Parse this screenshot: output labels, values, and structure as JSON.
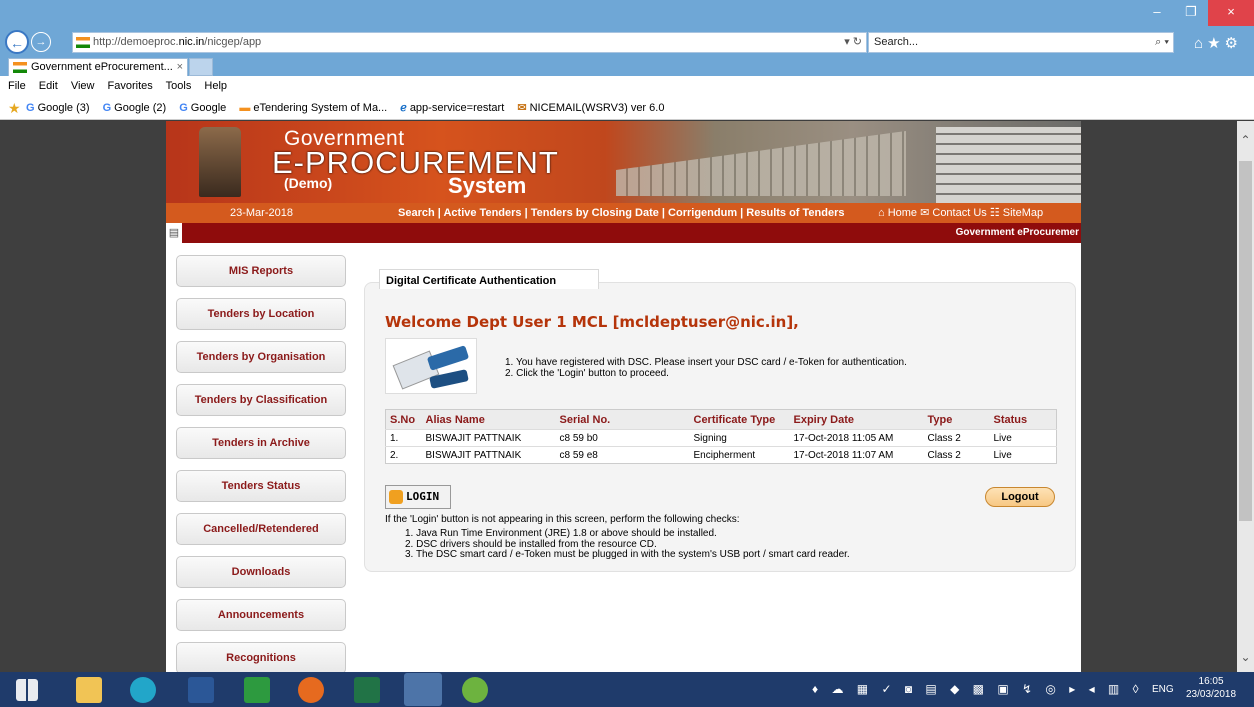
{
  "browser": {
    "url_prefix": "http://demoeproc.",
    "url_host": "nic.in",
    "url_path": "/nicgep/app",
    "refresh_glyph": "▾ ↻",
    "search_placeholder": "Search...",
    "search_glyph": "⌕ ▾",
    "nav_icons": "⌂★⚙",
    "tab_title": "Government eProcurement...",
    "tab_close": "×",
    "win_min": "–",
    "win_max": "❐",
    "win_close": "×",
    "back_glyph": "←",
    "fwd_glyph": "→"
  },
  "menu": [
    "File",
    "Edit",
    "View",
    "Favorites",
    "Tools",
    "Help"
  ],
  "favorites": [
    {
      "icon": "G",
      "label": "Google (3)"
    },
    {
      "icon": "G",
      "label": "Google (2)"
    },
    {
      "icon": "G",
      "label": "Google"
    },
    {
      "icon": "▬",
      "label": "eTendering System of Ma..."
    },
    {
      "icon": "ℯ",
      "label": "app-service=restart"
    },
    {
      "icon": "✉",
      "label": "NICEMAIL(WSRV3) ver 6.0"
    }
  ],
  "banner": {
    "line1": "Government",
    "line2": "E-PROCUREMENT",
    "line3": "(Demo)",
    "line4": "System"
  },
  "nav": {
    "date": "23-Mar-2018",
    "links": "Search  |  Active Tenders  |  Tenders by Closing Date  |  Corrigendum  |  Results of Tenders",
    "top_links": "⌂ Home   ✉ Contact Us   ☷ SiteMap",
    "marquee": "Government eProcuremer"
  },
  "sidebar": [
    "MIS Reports",
    "Tenders by Location",
    "Tenders by Organisation",
    "Tenders by Classification",
    "Tenders in Archive",
    "Tenders Status",
    "Cancelled/Retendered",
    "Downloads",
    "Announcements",
    "Recognitions"
  ],
  "auth": {
    "tab_label": "Digital Certificate Authentication",
    "welcome": "Welcome Dept User 1 MCL [mcldeptuser@nic.in],",
    "instructions": [
      "1.  You have registered with DSC. Please insert your DSC card / e-Token for authentication.",
      "2.  Click the 'Login' button to proceed."
    ],
    "columns": [
      "S.No",
      "Alias Name",
      "Serial No.",
      "Certificate Type",
      "Expiry Date",
      "Type",
      "Status"
    ],
    "rows": [
      [
        "1.",
        "BISWAJIT PATTNAIK",
        "c8 59 b0",
        "Signing",
        "17-Oct-2018 11:05 AM",
        "Class 2",
        "Live"
      ],
      [
        "2.",
        "BISWAJIT PATTNAIK",
        "c8 59 e8",
        "Encipherment",
        "17-Oct-2018 11:07 AM",
        "Class 2",
        "Live"
      ]
    ],
    "login_label": "LOGIN",
    "logout_label": "Logout",
    "checks_title": "If the 'Login' button is not appearing in this screen, perform the following checks:",
    "checks": [
      "1.  Java Run Time Environment (JRE) 1.8 or above should be installed.",
      "2.  DSC drivers should be installed from the resource CD.",
      "3.  The DSC smart card / e-Token must be plugged in with the system's USB port / smart card reader."
    ]
  },
  "taskbar": {
    "tray": "♦ ☁ ▦ ✓ ◙ ▤ ◆ ▩ ▣ ↯ ◎ ▸ ◂ ▥ ◊",
    "lang": "ENG",
    "time": "16:05",
    "date": "23/03/2018"
  }
}
